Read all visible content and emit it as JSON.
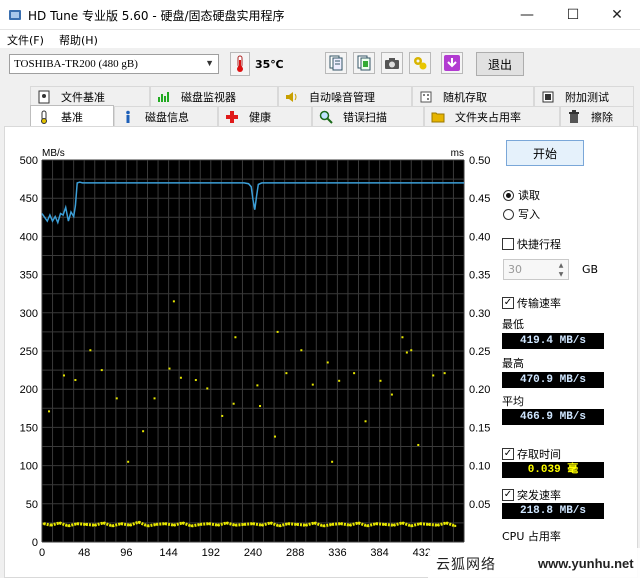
{
  "window": {
    "title": "HD Tune 专业版 5.60 - 硬盘/固态硬盘实用程序",
    "minimize": "—",
    "maximize": "☐",
    "close": "✕"
  },
  "menu": {
    "file": "文件(F)",
    "help": "帮助(H)"
  },
  "toolbar": {
    "drive": "TOSHIBA-TR200 (480 gB)",
    "temperature": "35℃",
    "exit": "退出",
    "icons": [
      "copy-info-icon",
      "copy-screenshot-icon",
      "camera-icon",
      "tools-icon",
      "save-icon"
    ]
  },
  "tabs_row1": [
    {
      "label": "文件基准",
      "icon": "file-benchmark-icon"
    },
    {
      "label": "磁盘监视器",
      "icon": "disk-monitor-icon"
    },
    {
      "label": "自动噪音管理",
      "icon": "speaker-icon"
    },
    {
      "label": "随机存取",
      "icon": "random-access-icon"
    },
    {
      "label": "附加测试",
      "icon": "extra-tests-icon"
    }
  ],
  "tabs_row2": [
    {
      "label": "基准",
      "icon": "benchmark-icon",
      "active": true
    },
    {
      "label": "磁盘信息",
      "icon": "info-icon"
    },
    {
      "label": "健康",
      "icon": "health-cross-icon"
    },
    {
      "label": "错误扫描",
      "icon": "magnifier-icon"
    },
    {
      "label": "文件夹占用率",
      "icon": "folder-icon"
    },
    {
      "label": "擦除",
      "icon": "trash-icon"
    }
  ],
  "panel": {
    "start": "开始",
    "read": "读取",
    "write": "写入",
    "read_selected": true,
    "short_stroke": "快捷行程",
    "short_stroke_checked": false,
    "short_stroke_value": "30",
    "gb": "GB",
    "transfer_rate": "传输速率",
    "transfer_rate_checked": true,
    "min_label": "最低",
    "min_value": "419.4 MB/s",
    "max_label": "最高",
    "max_value": "470.9 MB/s",
    "avg_label": "平均",
    "avg_value": "466.9 MB/s",
    "access_time": "存取时间",
    "access_time_checked": true,
    "access_value": "0.039 毫",
    "burst_rate": "突发速率",
    "burst_rate_checked": true,
    "burst_value": "218.8 MB/s",
    "cpu_usage": "CPU 占用率"
  },
  "watermark": {
    "text": "云狐网络",
    "url": "www.yunhu.net"
  },
  "colors": {
    "chart_bg": "#000000",
    "grid": "#3a3a3a",
    "transfer_line": "#3c9fd8",
    "access_dots": "#e6e600"
  },
  "chart_data": {
    "type": "line",
    "ylabel_left": "MB/s",
    "ylabel_right": "ms",
    "ylim_left": [
      0,
      500
    ],
    "ylim_right": [
      0,
      0.5
    ],
    "xlim": [
      0,
      480
    ],
    "left_ticks": [
      "0",
      "50",
      "100",
      "150",
      "200",
      "250",
      "300",
      "350",
      "400",
      "450",
      "500"
    ],
    "right_ticks": [
      "0.05",
      "0.10",
      "0.15",
      "0.20",
      "0.25",
      "0.30",
      "0.35",
      "0.40",
      "0.45",
      "0.50"
    ],
    "x_ticks": [
      "0",
      "48",
      "96",
      "144",
      "192",
      "240",
      "288",
      "336",
      "384",
      "432"
    ],
    "grid": true,
    "series": [
      {
        "x": [
          0,
          3,
          6,
          9,
          12,
          15,
          18,
          21,
          24,
          27,
          30,
          33,
          36,
          38,
          40,
          43,
          46,
          60,
          100,
          150,
          200,
          230,
          235,
          238,
          240,
          242,
          244,
          246,
          250,
          300,
          350,
          400,
          450,
          480
        ],
        "y": [
          430,
          425,
          420,
          428,
          420,
          426,
          418,
          430,
          428,
          438,
          420,
          432,
          426,
          440,
          470,
          471,
          470,
          470,
          470,
          470,
          470,
          470,
          469,
          465,
          448,
          435,
          452,
          468,
          470,
          470,
          470,
          470,
          470,
          470
        ]
      },
      {
        "x": [
          2,
          10,
          20,
          30,
          40,
          50,
          60,
          70,
          80,
          90,
          100,
          110,
          120,
          130,
          140,
          150,
          160,
          170,
          180,
          190,
          200,
          210,
          220,
          230,
          240,
          250,
          260,
          270,
          280,
          290,
          300,
          310,
          320,
          330,
          340,
          350,
          360,
          370,
          380,
          390,
          400,
          410,
          420,
          430,
          440,
          450,
          460,
          470,
          25,
          55,
          85,
          115,
          145,
          175,
          205,
          245,
          265,
          295,
          325,
          355,
          385,
          415,
          445,
          8,
          38,
          68,
          98,
          128,
          158,
          188,
          218,
          248,
          278,
          308,
          338,
          368,
          398,
          428,
          458,
          150,
          220,
          268,
          330,
          410,
          420
        ],
        "y": [
          0.024,
          0.022,
          0.025,
          0.021,
          0.024,
          0.023,
          0.022,
          0.025,
          0.021,
          0.024,
          0.022,
          0.026,
          0.021,
          0.023,
          0.024,
          0.022,
          0.025,
          0.021,
          0.023,
          0.024,
          0.022,
          0.025,
          0.022,
          0.023,
          0.024,
          0.022,
          0.025,
          0.021,
          0.024,
          0.023,
          0.022,
          0.025,
          0.021,
          0.023,
          0.024,
          0.022,
          0.025,
          0.021,
          0.024,
          0.023,
          0.022,
          0.025,
          0.021,
          0.024,
          0.023,
          0.022,
          0.025,
          0.021,
          0.218,
          0.251,
          0.188,
          0.145,
          0.227,
          0.212,
          0.165,
          0.205,
          0.138,
          0.251,
          0.235,
          0.221,
          0.211,
          0.248,
          0.218,
          0.171,
          0.212,
          0.225,
          0.105,
          0.188,
          0.215,
          0.201,
          0.181,
          0.178,
          0.221,
          0.206,
          0.211,
          0.158,
          0.193,
          0.127,
          0.221,
          0.315,
          0.268,
          0.275,
          0.105,
          0.268,
          0.251
        ]
      }
    ]
  }
}
